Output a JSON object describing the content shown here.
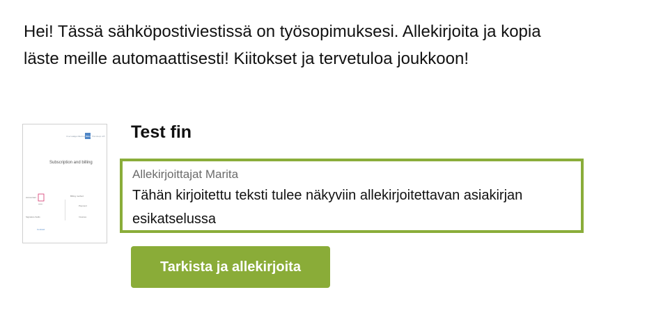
{
  "email": {
    "intro_line1": "Hei! Tässä sähköpostiviestissä on työsopimuksesi. Allekirjoita ja kopia",
    "intro_line2": "läste meille automaattisesti! Kiitokset ja tervetuloa joukkoon!"
  },
  "document": {
    "title": "Test fin",
    "thumbnail": {
      "heading": "Subscription and billing",
      "nav_items": [
        "Overview",
        "Agents",
        "Settings",
        "Billing",
        "Plans",
        "Help",
        "API"
      ],
      "left_labels": [
        "Accountant",
        "Signature fields",
        "Contract"
      ],
      "right_labels": [
        "Billing method",
        "Payment",
        "Invoices"
      ]
    }
  },
  "signers_box": {
    "label": "Allekirjoittajat Marita",
    "text": "Tähän kirjoitettu teksti tulee näkyviin allekirjoitettavan asiakirjan esikatselussa"
  },
  "actions": {
    "sign_label": "Tarkista ja allekirjoita"
  },
  "colors": {
    "accent_green": "#8aac38",
    "box_border": "#8aad3a",
    "thumb_highlight": "#4f86c6",
    "thumb_mark": "#d6336c"
  }
}
